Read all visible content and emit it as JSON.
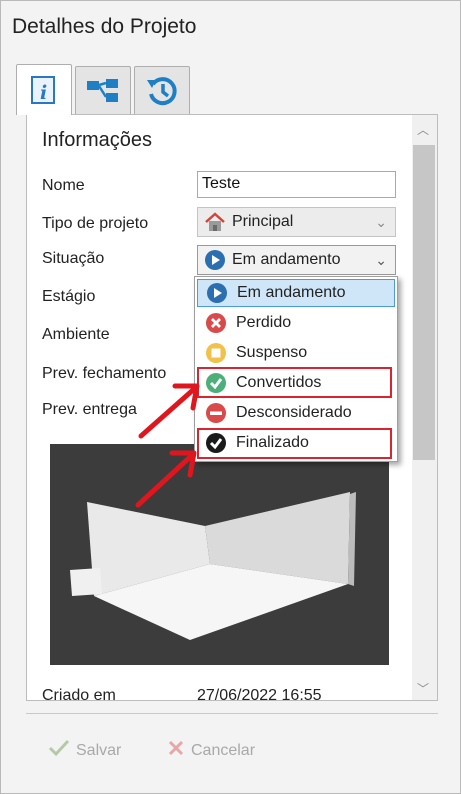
{
  "window": {
    "title": "Detalhes do Projeto"
  },
  "tabs": [
    {
      "name": "info",
      "icon": "info-icon"
    },
    {
      "name": "structure",
      "icon": "hierarchy-icon"
    },
    {
      "name": "history",
      "icon": "history-icon"
    }
  ],
  "section": {
    "title": "Informações"
  },
  "fields": {
    "nome": {
      "label": "Nome",
      "value": "Teste"
    },
    "tipo": {
      "label": "Tipo de projeto",
      "value": "Principal",
      "icon": "house-icon"
    },
    "situacao": {
      "label": "Situação",
      "value": "Em andamento",
      "icon": "play-icon"
    },
    "estagio": {
      "label": "Estágio"
    },
    "ambiente": {
      "label": "Ambiente"
    },
    "prev_fechamento": {
      "label": "Prev. fechamento"
    },
    "prev_entrega": {
      "label": "Prev. entrega"
    },
    "criado": {
      "label": "Criado em",
      "value": "27/06/2022 16:55"
    }
  },
  "dropdown": {
    "options": [
      {
        "label": "Em andamento",
        "icon": "play-icon",
        "color": "#2c6fb0",
        "selected": true
      },
      {
        "label": "Perdido",
        "icon": "x-circle-icon",
        "color": "#d94a4a"
      },
      {
        "label": "Suspenso",
        "icon": "pause-icon",
        "color": "#f2c14a"
      },
      {
        "label": "Convertidos",
        "icon": "check-circle-icon",
        "color": "#4caf7a",
        "highlighted": true
      },
      {
        "label": "Desconsiderado",
        "icon": "minus-circle-icon",
        "color": "#d94a4a"
      },
      {
        "label": "Finalizado",
        "icon": "check-dark-icon",
        "color": "#1a1a1a",
        "highlighted": true
      }
    ]
  },
  "actions": {
    "save": {
      "label": "Salvar",
      "icon": "check-icon"
    },
    "cancel": {
      "label": "Cancelar",
      "icon": "x-icon"
    }
  },
  "colors": {
    "highlight": "#d9252f",
    "selection_bg": "#cfe6f8",
    "selection_border": "#4a9bdc"
  }
}
